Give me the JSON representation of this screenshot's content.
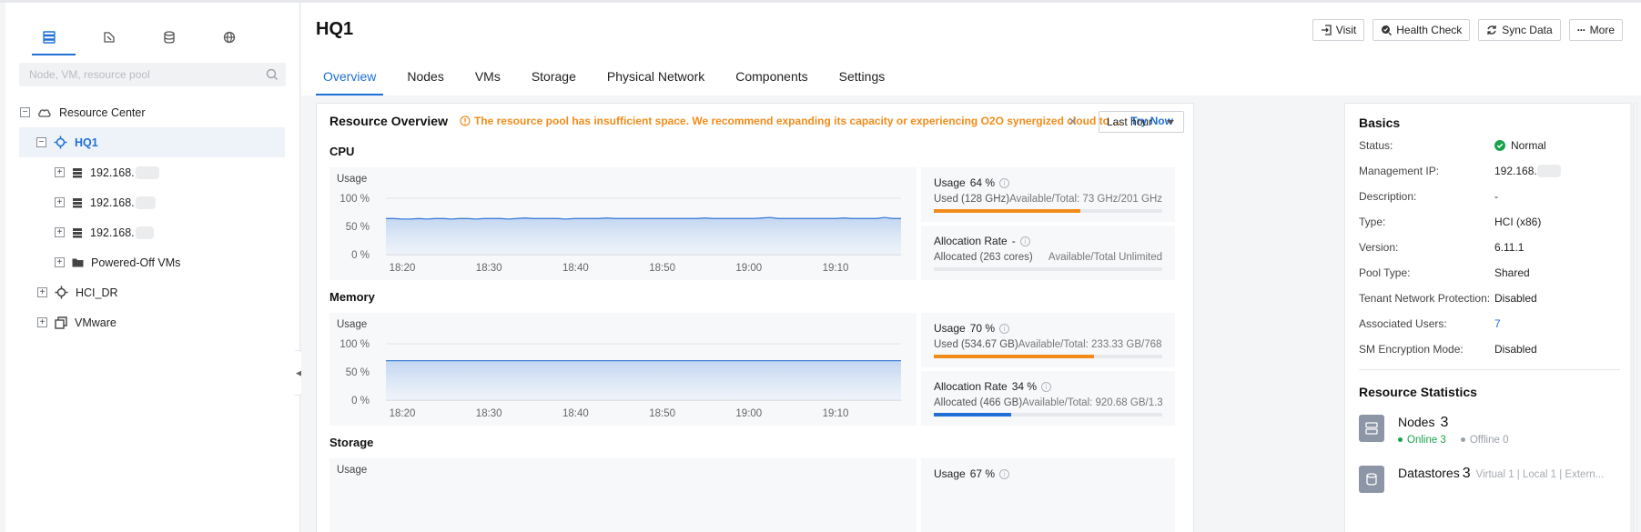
{
  "sidebar": {
    "tabs": [
      {
        "icon": "host-list-icon",
        "active": true
      },
      {
        "icon": "edit-shape-icon",
        "active": false
      },
      {
        "icon": "datastore-icon",
        "active": false
      },
      {
        "icon": "globe-icon",
        "active": false
      }
    ],
    "search_placeholder": "Node, VM, resource pool",
    "tree": {
      "root_label": "Resource Center",
      "hq1_label": "HQ1",
      "node1_label": "192.168.",
      "node2_label": "192.168.",
      "node3_label": "192.168.",
      "powered_off_label": "Powered-Off VMs",
      "hci_dr_label": "HCI_DR",
      "vmware_label": "VMware"
    }
  },
  "header": {
    "title": "HQ1",
    "actions": {
      "visit": "Visit",
      "health_check": "Health Check",
      "sync_data": "Sync Data",
      "more": "More"
    },
    "tabs": {
      "overview": "Overview",
      "nodes": "Nodes",
      "vms": "VMs",
      "storage": "Storage",
      "physical_network": "Physical Network",
      "components": "Components",
      "settings": "Settings"
    }
  },
  "overview": {
    "title": "Resource Overview",
    "warning": "The resource pool has insufficient space. We recommend expanding its capacity or experiencing O2O synergized cloud to ...",
    "try_now": "Try Now",
    "time_range": "Last hour",
    "cpu": {
      "section": "CPU",
      "chart_usage_label": "Usage",
      "usage_label": "Usage",
      "usage_value": "64 %",
      "used_text": "Used (128 GHz)",
      "available_text": "Available/Total: 73 GHz/201 GHz",
      "usage_fraction": 0.64,
      "alloc_label": "Allocation Rate",
      "alloc_value": "-",
      "allocated_text": "Allocated (263 cores)",
      "alloc_available_text": "Available/Total Unlimited",
      "alloc_fraction": 0
    },
    "memory": {
      "section": "Memory",
      "chart_usage_label": "Usage",
      "usage_label": "Usage",
      "usage_value": "70 %",
      "used_text": "Used (534.67 GB)",
      "available_text": "Available/Total: 233.33 GB/768 ...",
      "usage_fraction": 0.7,
      "alloc_label": "Allocation Rate",
      "alloc_value": "34 %",
      "allocated_text": "Allocated (466 GB)",
      "alloc_available_text": "Available/Total: 920.68 GB/1.3...",
      "alloc_fraction": 0.34
    },
    "storage": {
      "section": "Storage",
      "chart_usage_label": "Usage",
      "usage_label": "Usage",
      "usage_value": "67 %"
    }
  },
  "chart_data": [
    {
      "type": "area",
      "title": "CPU",
      "ylabel": "Usage",
      "yticks": [
        "100 %",
        "50 %",
        "0 %"
      ],
      "ylim": [
        0,
        100
      ],
      "xticks": [
        "18:20",
        "18:30",
        "18:40",
        "18:50",
        "19:00",
        "19:10"
      ],
      "series": [
        {
          "values": [
            64,
            64,
            63,
            63,
            64,
            63,
            64,
            64,
            63,
            64,
            64,
            63,
            64,
            64,
            64,
            63,
            64,
            65,
            64,
            64,
            64,
            64,
            63,
            64,
            64,
            64,
            64,
            65,
            64,
            64,
            64,
            64,
            64,
            64,
            64,
            64,
            64,
            64,
            64,
            65,
            64,
            64,
            64,
            64,
            64,
            64,
            65,
            66,
            64,
            64,
            64,
            64,
            64,
            64,
            64,
            64,
            65,
            64,
            64,
            64,
            64,
            66,
            64,
            64
          ]
        }
      ]
    },
    {
      "type": "area",
      "title": "Memory",
      "ylabel": "Usage",
      "yticks": [
        "100 %",
        "50 %",
        "0 %"
      ],
      "ylim": [
        0,
        100
      ],
      "xticks": [
        "18:20",
        "18:30",
        "18:40",
        "18:50",
        "19:00",
        "19:10"
      ],
      "series": [
        {
          "values": [
            70,
            70,
            70,
            70,
            70,
            70,
            70,
            70,
            70,
            70,
            70,
            70,
            70,
            70,
            70,
            70,
            70,
            70,
            70,
            70,
            70,
            70,
            70,
            70,
            70,
            70,
            70,
            70,
            70,
            70,
            70,
            70,
            70,
            70,
            70,
            70,
            70,
            70,
            70,
            70
          ]
        }
      ]
    }
  ],
  "basics": {
    "title": "Basics",
    "status_label": "Status:",
    "status_value": "Normal",
    "mgmt_ip_label": "Management IP:",
    "mgmt_ip_value": "192.168.",
    "description_label": "Description:",
    "description_value": "-",
    "type_label": "Type:",
    "type_value": "HCI (x86)",
    "version_label": "Version:",
    "version_value": "6.11.1",
    "pool_type_label": "Pool Type:",
    "pool_type_value": "Shared",
    "tenant_label": "Tenant Network Protection:",
    "tenant_value": "Disabled",
    "users_label": "Associated Users:",
    "users_value": "7",
    "sm_label": "SM Encryption Mode:",
    "sm_value": "Disabled"
  },
  "resource_stats": {
    "title": "Resource Statistics",
    "nodes_label": "Nodes",
    "nodes_count": "3",
    "online_text": "Online 3",
    "offline_text": "Offline 0",
    "datastores_label": "Datastores",
    "datastores_count": "3",
    "datastores_extra": "Virtual 1 | Local 1 | Extern..."
  },
  "colors": {
    "accent": "#1f6fd6",
    "warning": "#f18c1a",
    "usage_bar": "#f18c1a",
    "alloc_bar": "#1f6fd6",
    "online": "#17a34a",
    "offline": "#9aa0a8"
  }
}
